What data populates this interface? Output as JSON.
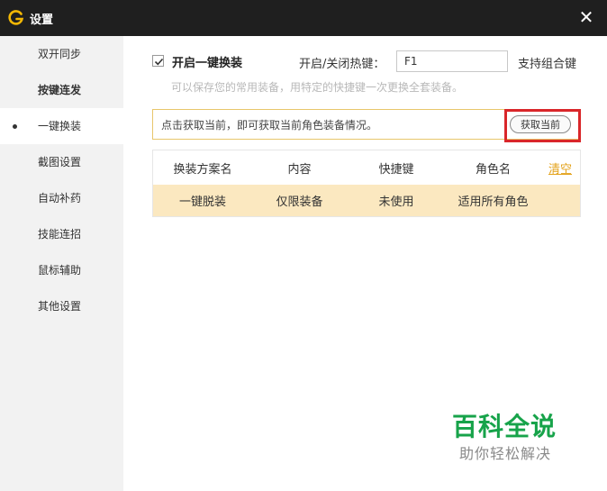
{
  "window": {
    "title": "设置",
    "close_glyph": "✕",
    "logo_icon": "g-logo-icon",
    "logo_color": "#f2b705"
  },
  "sidebar": {
    "items": [
      {
        "label": "双开同步",
        "active": false
      },
      {
        "label": "按键连发",
        "active": false
      },
      {
        "label": "一键换装",
        "active": true
      },
      {
        "label": "截图设置",
        "active": false
      },
      {
        "label": "自动补药",
        "active": false
      },
      {
        "label": "技能连招",
        "active": false
      },
      {
        "label": "鼠标辅助",
        "active": false
      },
      {
        "label": "其他设置",
        "active": false
      }
    ]
  },
  "outfit": {
    "enable_checked": true,
    "enable_label": "开启一键换装",
    "hotkey_label": "开启/关闭热键：",
    "hotkey_value": "F1",
    "support_combo_label": "支持组合键",
    "hint": "可以保存您的常用装备，用特定的快捷键一次更换全套装备。",
    "notice_text": "点击获取当前，即可获取当前角色装备情况。",
    "fetch_button_label": "获取当前",
    "highlight_color": "#d9262a",
    "accent_color": "#e3a21a"
  },
  "table": {
    "headers": [
      "换装方案名",
      "内容",
      "快捷键",
      "角色名"
    ],
    "clear_label": "清空",
    "rows": [
      [
        "一键脱装",
        "仅限装备",
        "未使用",
        "适用所有角色"
      ]
    ],
    "selected_row_color": "#fbe8c0"
  },
  "watermark": {
    "title": "百科全说",
    "subtitle": "助你轻松解决",
    "color": "#17a34a"
  }
}
